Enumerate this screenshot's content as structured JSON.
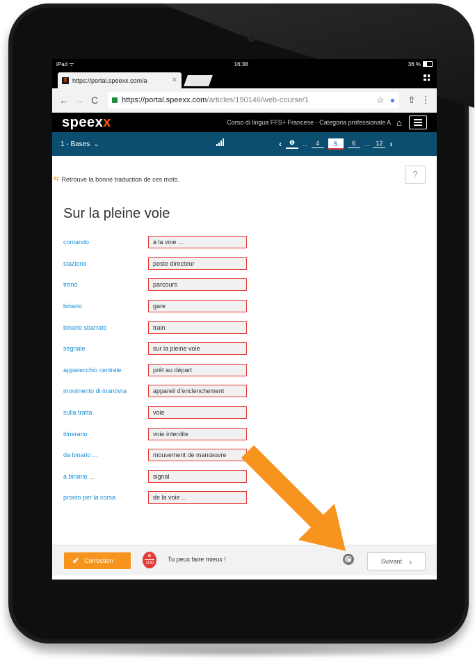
{
  "status_bar": {
    "left": "iPad ᯤ",
    "time": "16:38",
    "battery": "36 %"
  },
  "browser": {
    "tab_title": "https://portal.speexx.com/a",
    "url_host": "https://portal.speexx.com",
    "url_path": "/articles/190146/web-course/1"
  },
  "app": {
    "logo_main": "speex",
    "logo_accent": "x",
    "course_title": "Corso di lingua FFS+ Francese - Categoria professionale A"
  },
  "lesson": {
    "selector": "1 - Bases",
    "pages": [
      "4",
      "5",
      "6",
      "12"
    ],
    "active_page": "5"
  },
  "exercise": {
    "instruction": "Retrouve la bonne traduction de ces mots.",
    "help_label": "?",
    "title": "Sur la pleine voie",
    "rows": [
      {
        "word": "comando",
        "answer": "à la voie ..."
      },
      {
        "word": "stazione",
        "answer": "poste directeur"
      },
      {
        "word": "treno",
        "answer": "parcours"
      },
      {
        "word": "binario",
        "answer": "gare"
      },
      {
        "word": "binario sbarrato",
        "answer": "train"
      },
      {
        "word": "segnale",
        "answer": "sur la pleine voie"
      },
      {
        "word": "apparecchio centrale",
        "answer": "prêt au départ"
      },
      {
        "word": "movimento di manovra",
        "answer": "appareil d'enclenchement"
      },
      {
        "word": "sulla tratta",
        "answer": "voie"
      },
      {
        "word": "itinerario",
        "answer": "voie interdite"
      },
      {
        "word": "da binario ...",
        "answer": "mouvement de manœuvre"
      },
      {
        "word": "a binario ...",
        "answer": "signal"
      },
      {
        "word": "pronto per la corsa",
        "answer": "de la voie ..."
      }
    ]
  },
  "footer": {
    "correction_label": "Correction",
    "score_value": "0",
    "score_max": "100",
    "feedback": "Tu peux faire mieux !",
    "next_label": "Suivant"
  },
  "colors": {
    "accent": "#f7941d",
    "error": "#e53935",
    "lesson_bar": "#0b4e6f",
    "link": "#1e90d8"
  }
}
